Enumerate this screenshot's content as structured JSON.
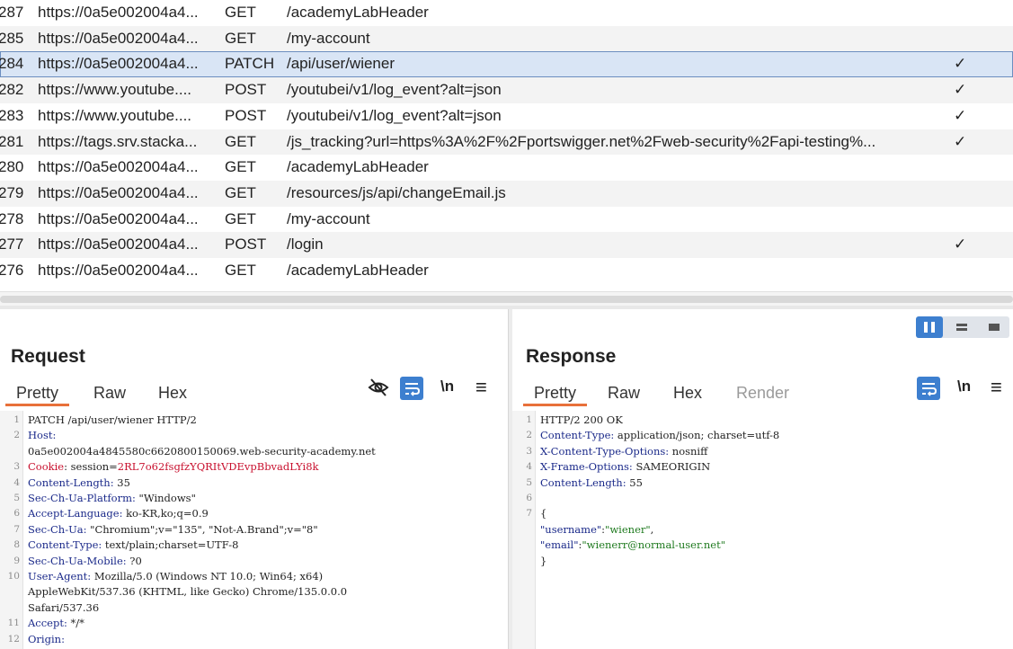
{
  "history": {
    "rows": [
      {
        "num": "287",
        "host": "https://0a5e002004a4...",
        "method": "GET",
        "url": "/academyLabHeader",
        "edited": ""
      },
      {
        "num": "285",
        "host": "https://0a5e002004a4...",
        "method": "GET",
        "url": "/my-account",
        "edited": ""
      },
      {
        "num": "284",
        "host": "https://0a5e002004a4...",
        "method": "PATCH",
        "url": "/api/user/wiener",
        "edited": "✓"
      },
      {
        "num": "282",
        "host": "https://www.youtube....",
        "method": "POST",
        "url": "/youtubei/v1/log_event?alt=json",
        "edited": "✓"
      },
      {
        "num": "283",
        "host": "https://www.youtube....",
        "method": "POST",
        "url": "/youtubei/v1/log_event?alt=json",
        "edited": "✓"
      },
      {
        "num": "281",
        "host": "https://tags.srv.stacka...",
        "method": "GET",
        "url": "/js_tracking?url=https%3A%2F%2Fportswigger.net%2Fweb-security%2Fapi-testing%...",
        "edited": "✓"
      },
      {
        "num": "280",
        "host": "https://0a5e002004a4...",
        "method": "GET",
        "url": "/academyLabHeader",
        "edited": ""
      },
      {
        "num": "279",
        "host": "https://0a5e002004a4...",
        "method": "GET",
        "url": "/resources/js/api/changeEmail.js",
        "edited": ""
      },
      {
        "num": "278",
        "host": "https://0a5e002004a4...",
        "method": "GET",
        "url": "/my-account",
        "edited": ""
      },
      {
        "num": "277",
        "host": "https://0a5e002004a4...",
        "method": "POST",
        "url": "/login",
        "edited": "✓"
      },
      {
        "num": "276",
        "host": "https://0a5e002004a4...",
        "method": "GET",
        "url": "/academyLabHeader",
        "edited": ""
      }
    ],
    "selected_num": "284"
  },
  "request": {
    "title": "Request",
    "tabs": [
      {
        "label": "Pretty",
        "active": true
      },
      {
        "label": "Raw",
        "active": false
      },
      {
        "label": "Hex",
        "active": false
      }
    ],
    "newline_label": "\\n",
    "lines": [
      {
        "n": "1",
        "key": "",
        "value": "PATCH /api/user/wiener HTTP/2"
      },
      {
        "n": "2",
        "key": "Host",
        "value": ""
      },
      {
        "n": "",
        "key": "",
        "value": "0a5e002004a4845580c6620800150069.web-security-academy.net"
      },
      {
        "n": "3",
        "key": "Cookie",
        "value": " session=",
        "cookie_value": "2RL7o62fsgfzYQRItVDEvpBbvadLYi8k"
      },
      {
        "n": "4",
        "key": "Content-Length",
        "value": " 35"
      },
      {
        "n": "5",
        "key": "Sec-Ch-Ua-Platform",
        "value": " \"Windows\""
      },
      {
        "n": "6",
        "key": "Accept-Language",
        "value": " ko-KR,ko;q=0.9"
      },
      {
        "n": "7",
        "key": "Sec-Ch-Ua",
        "value": " \"Chromium\";v=\"135\", \"Not-A.Brand\";v=\"8\""
      },
      {
        "n": "8",
        "key": "Content-Type",
        "value": " text/plain;charset=UTF-8"
      },
      {
        "n": "9",
        "key": "Sec-Ch-Ua-Mobile",
        "value": " ?0"
      },
      {
        "n": "10",
        "key": "User-Agent",
        "value": " Mozilla/5.0 (Windows NT 10.0; Win64; x64)"
      },
      {
        "n": "",
        "key": "",
        "value": "AppleWebKit/537.36 (KHTML, like Gecko) Chrome/135.0.0.0"
      },
      {
        "n": "",
        "key": "",
        "value": "Safari/537.36"
      },
      {
        "n": "11",
        "key": "Accept",
        "value": " */*"
      },
      {
        "n": "12",
        "key": "Origin",
        "value": ""
      }
    ]
  },
  "response": {
    "title": "Response",
    "tabs": [
      {
        "label": "Pretty",
        "active": true
      },
      {
        "label": "Raw",
        "active": false
      },
      {
        "label": "Hex",
        "active": false
      },
      {
        "label": "Render",
        "active": false,
        "disabled": true
      }
    ],
    "newline_label": "\\n",
    "lines": [
      {
        "n": "1",
        "key": "",
        "value": "HTTP/2 200 OK"
      },
      {
        "n": "2",
        "key": "Content-Type",
        "value": " application/json; charset=utf-8"
      },
      {
        "n": "3",
        "key": "X-Content-Type-Options",
        "value": " nosniff"
      },
      {
        "n": "4",
        "key": "X-Frame-Options",
        "value": " SAMEORIGIN"
      },
      {
        "n": "5",
        "key": "Content-Length",
        "value": " 55"
      },
      {
        "n": "6",
        "key": "",
        "value": ""
      },
      {
        "n": "7",
        "key": "",
        "value": "{"
      },
      {
        "n": "",
        "json_key": "\"username\"",
        "json_value": "\"wiener\"",
        "trail": ","
      },
      {
        "n": "",
        "json_key": "\"email\"",
        "json_value": "\"wienerr@normal-user.net\"",
        "trail": ""
      },
      {
        "n": "",
        "key": "",
        "value": "}"
      }
    ]
  },
  "colors": {
    "accent_blue": "#3d7fcf",
    "tab_underline": "#e8703a",
    "selected_row": "#d9e5f5",
    "header_key": "#1b2a8a",
    "cookie": "#c8102e",
    "json_string": "#1f7a1f"
  },
  "icons": {
    "hide": "eye-slash-icon",
    "wrap": "word-wrap-icon",
    "menu": "hamburger-menu-icon",
    "layout_split": "layout-side-by-side-icon",
    "layout_stack": "layout-stacked-icon",
    "layout_single": "layout-single-icon"
  }
}
